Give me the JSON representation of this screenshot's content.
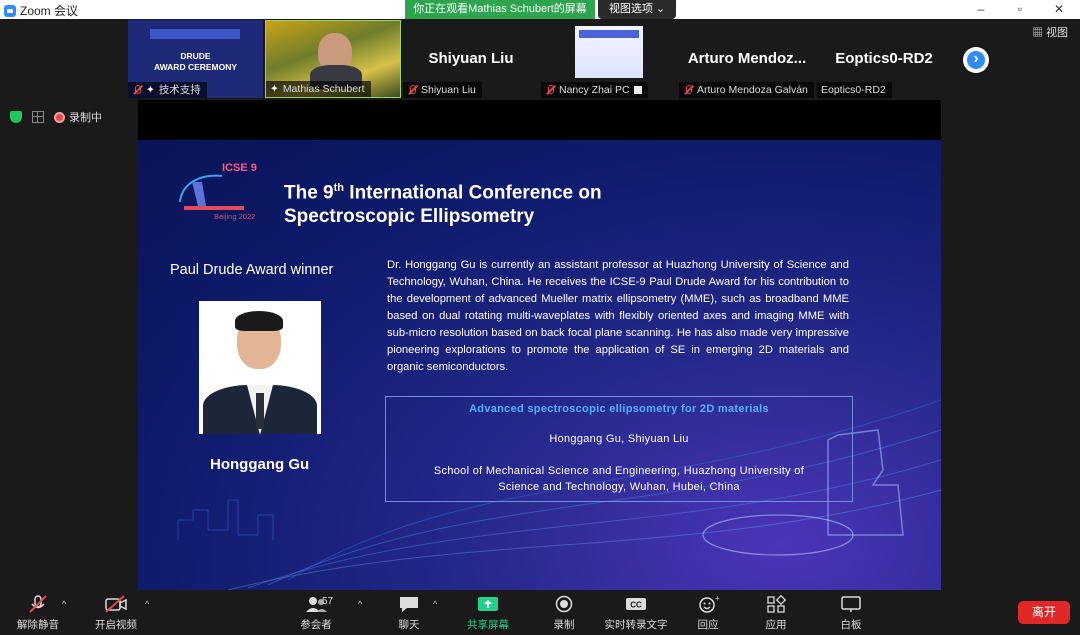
{
  "window": {
    "title": "Zoom 会议"
  },
  "share_banner": "你正在观看Mathias  Schubert的屏幕",
  "view_options": "视图选项",
  "window_controls": {
    "minimize": "–",
    "maximize": "▫",
    "close": "✕"
  },
  "view_toggle": "视图",
  "participants_strip": [
    {
      "name": "技术支持",
      "big": "",
      "muted": true
    },
    {
      "name": "Mathias Schubert",
      "big": "",
      "muted": false
    },
    {
      "name": "Shiyuan Liu",
      "big": "Shiyuan Liu",
      "muted": true
    },
    {
      "name": "Nancy Zhai PC",
      "big": "",
      "muted": true
    },
    {
      "name": "Arturo Mendoza Galván",
      "big": "Arturo  Mendoz...",
      "muted": true
    },
    {
      "name": "Eoptics0-RD2",
      "big": "Eoptics0-RD2",
      "muted": false
    }
  ],
  "thumb_slide_text": {
    "ceremony": "DRUDE\nAWARD CEREMONY"
  },
  "recording": "录制中",
  "slide": {
    "title_line1_pre": "The 9",
    "title_sup": "th",
    "title_line1_post": " International Conference on",
    "title_line2": "Spectroscopic Ellipsometry",
    "logo_text": "ICSE 9",
    "logo_city": "Beijing 2022",
    "award_label": "Paul Drude Award winner",
    "winner_name": "Honggang Gu",
    "bio": "Dr. Honggang Gu is currently an assistant professor at Huazhong University of Science and Technology, Wuhan, China. He receives the ICSE-9 Paul Drude Award for his contribution to the development of advanced Mueller matrix ellipsometry (MME), such as broadband MME based on dual rotating multi-waveplates with flexibly oriented axes and imaging MME with sub-micro resolution based on back focal plane scanning. He has also made very impressive pioneering explorations to promote the application of SE in emerging 2D materials and organic semiconductors.",
    "talk_title": "Advanced spectroscopic ellipsometry for 2D materials",
    "talk_authors": "Honggang Gu, Shiyuan Liu",
    "talk_affiliation_1": "School of Mechanical Science and Engineering, Huazhong University of",
    "talk_affiliation_2": "Science and Technology, Wuhan, Hubei, China"
  },
  "toolbar": {
    "unmute": "解除静音",
    "start_video": "开启视频",
    "participants": "参会者",
    "participants_count": "57",
    "chat": "聊天",
    "share": "共享屏幕",
    "record": "录制",
    "transcript": "实时转录文字",
    "reactions": "回应",
    "apps": "应用",
    "whiteboard": "白板",
    "leave": "离开"
  },
  "colors": {
    "share_green": "#2da44e",
    "accent_blue": "#2d8cff",
    "leave_red": "#e02828",
    "slide_bg": "#0e1a6b"
  }
}
